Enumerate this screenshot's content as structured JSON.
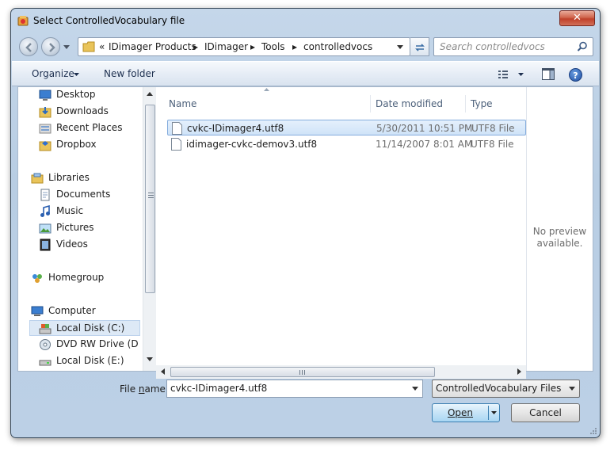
{
  "window": {
    "title": "Select ControlledVocabulary file",
    "close_glyph": "✕"
  },
  "address_bar": {
    "prefix": "«",
    "breadcrumbs": [
      "IDimager Products",
      "IDimager",
      "Tools",
      "controlledvocs"
    ],
    "separator": "▸"
  },
  "search": {
    "placeholder": "Search controlledvocs"
  },
  "toolbar": {
    "organize_label": "Organize",
    "new_folder_label": "New folder",
    "help_glyph": "?"
  },
  "nav_pane": {
    "items": [
      {
        "label": "Desktop",
        "icon": "desktop-icon"
      },
      {
        "label": "Downloads",
        "icon": "downloads-icon"
      },
      {
        "label": "Recent Places",
        "icon": "recent-places-icon"
      },
      {
        "label": "Dropbox",
        "icon": "dropbox-icon"
      },
      {
        "label": "Libraries",
        "icon": "libraries-icon"
      },
      {
        "label": "Documents",
        "icon": "documents-icon"
      },
      {
        "label": "Music",
        "icon": "music-icon"
      },
      {
        "label": "Pictures",
        "icon": "pictures-icon"
      },
      {
        "label": "Videos",
        "icon": "videos-icon"
      },
      {
        "label": "Homegroup",
        "icon": "homegroup-icon"
      },
      {
        "label": "Computer",
        "icon": "computer-icon"
      },
      {
        "label": "Local Disk (C:)",
        "icon": "hard-disk-icon",
        "selected": true
      },
      {
        "label": "DVD RW Drive (D",
        "icon": "dvd-drive-icon"
      },
      {
        "label": "Local Disk (E:)",
        "icon": "hard-disk-icon"
      }
    ]
  },
  "file_list": {
    "columns": [
      "Name",
      "Date modified",
      "Type"
    ],
    "rows": [
      {
        "name": "cvkc-IDimager4.utf8",
        "date": "5/30/2011 10:51 PM",
        "type": "UTF8 File",
        "selected": true
      },
      {
        "name": "idimager-cvkc-demov3.utf8",
        "date": "11/14/2007 8:01 AM",
        "type": "UTF8 File",
        "selected": false
      }
    ]
  },
  "preview": {
    "line1": "No preview",
    "line2": "available."
  },
  "file_name": {
    "label_prefix": "File ",
    "label_mnemonic": "n",
    "label_suffix": "ame:",
    "value": "cvkc-IDimager4.utf8"
  },
  "filter": {
    "selected": "ControlledVocabulary Files (*.u"
  },
  "buttons": {
    "open_label": "Open",
    "cancel_label": "Cancel"
  },
  "colors": {
    "window_frame": "#b8cde3",
    "selection": "#cfe3f8",
    "accent": "#3c7fb1"
  }
}
